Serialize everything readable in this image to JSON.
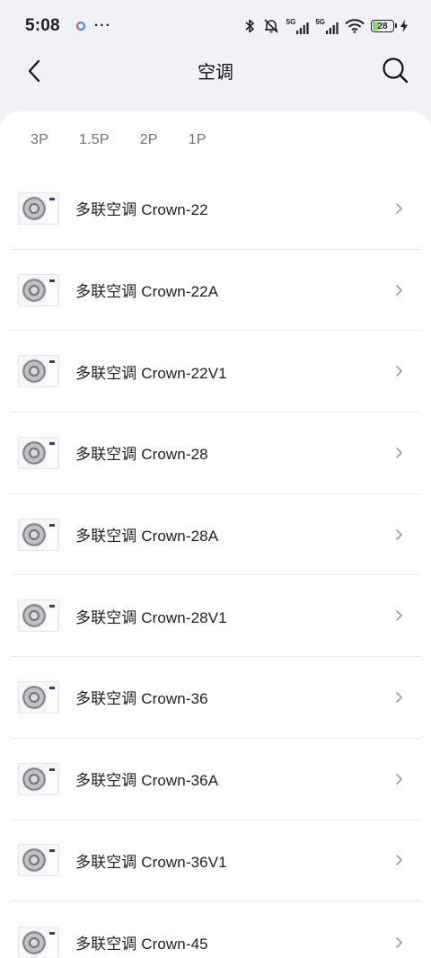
{
  "status_bar": {
    "time": "5:08",
    "more": "···",
    "net_tag_1": "5G",
    "net_tag_2": "5G",
    "battery": "28"
  },
  "header": {
    "title": "空调",
    "back_icon": "chevron-left-icon",
    "search_icon": "search-icon"
  },
  "tabs": [
    {
      "label": "3P"
    },
    {
      "label": "1.5P"
    },
    {
      "label": "2P"
    },
    {
      "label": "1P"
    }
  ],
  "products": [
    {
      "name": "多联空调 Crown-22"
    },
    {
      "name": "多联空调 Crown-22A"
    },
    {
      "name": "多联空调 Crown-22V1"
    },
    {
      "name": "多联空调 Crown-28"
    },
    {
      "name": "多联空调 Crown-28A"
    },
    {
      "name": "多联空调 Crown-28V1"
    },
    {
      "name": "多联空调 Crown-36"
    },
    {
      "name": "多联空调 Crown-36A"
    },
    {
      "name": "多联空调 Crown-36V1"
    },
    {
      "name": "多联空调 Crown-45"
    }
  ],
  "colors": {
    "background": "#f1f2f6",
    "card": "#ffffff",
    "tab_text": "#6f7176",
    "chevron": "#9a9ca1"
  }
}
